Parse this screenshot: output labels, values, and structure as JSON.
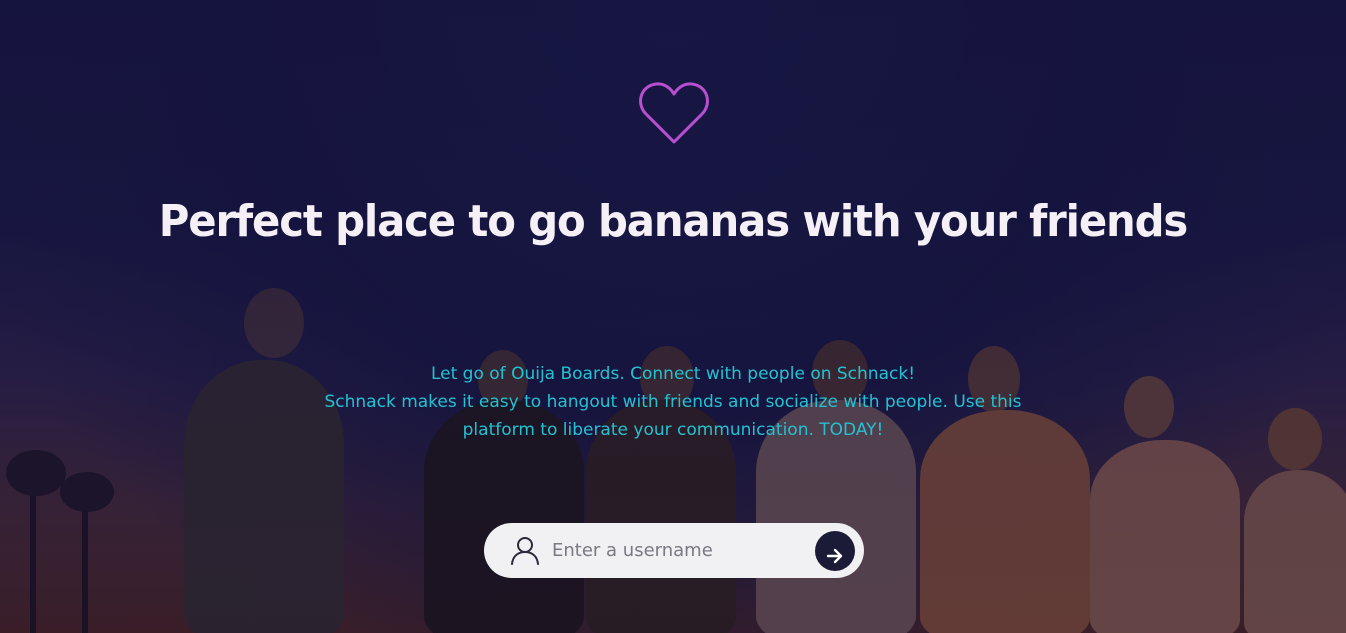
{
  "hero": {
    "headline": "Perfect place to go bananas with your friends",
    "tagline_lines": [
      "Let go of Ouija Boards. Connect with people on Schnack!",
      "Schnack makes it easy to hangout with friends and socialize with people. Use this",
      "platform to liberate your communication. TODAY!"
    ]
  },
  "username_form": {
    "placeholder": "Enter a username",
    "value": "",
    "user_icon": "user-outline-icon",
    "submit_icon": "arrow-right-icon"
  },
  "icons": {
    "logo": "heart-outline-icon"
  },
  "colors": {
    "heart_stroke": "#b84fd0",
    "headline": "#f4f0f6",
    "tagline": "#23c2d3",
    "input_bg": "#f1f0f3",
    "button_bg": "#1b1a37"
  }
}
